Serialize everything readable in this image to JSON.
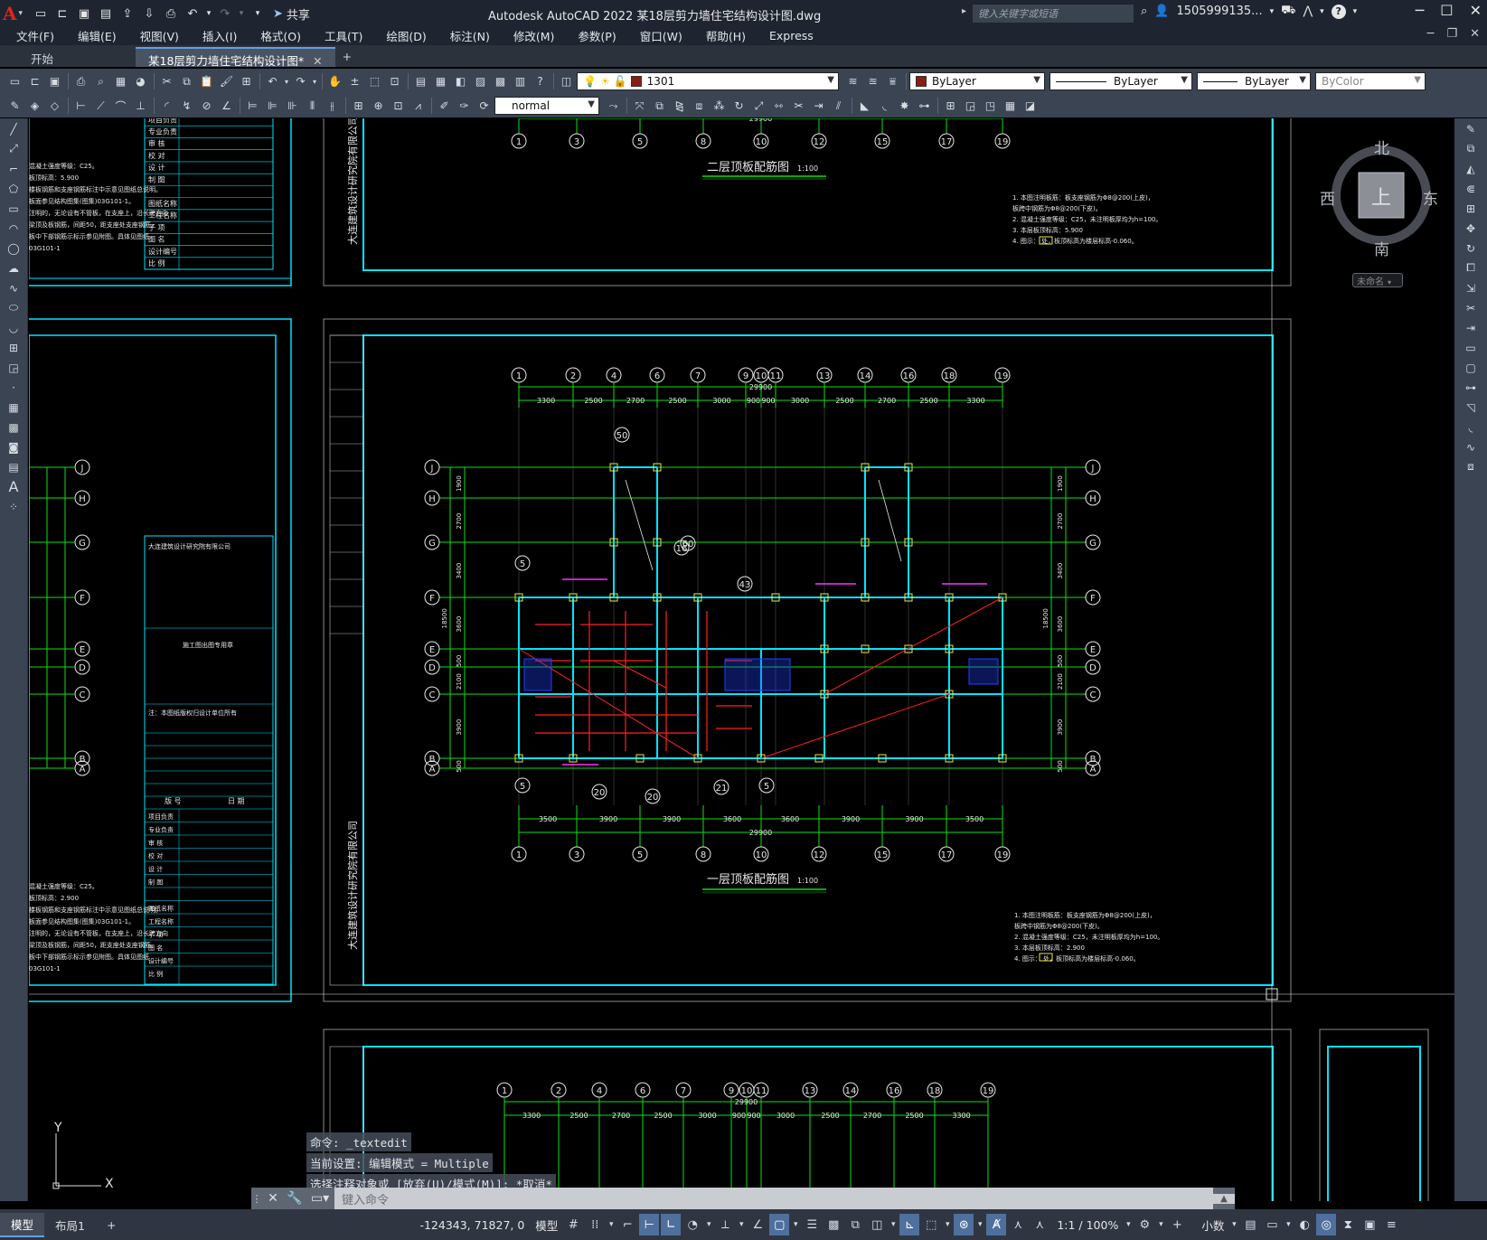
{
  "titlebar": {
    "app_letter": "A",
    "share_label": "共享",
    "title": "Autodesk AutoCAD 2022    某18层剪力墙住宅结构设计图.dwg",
    "search_placeholder": "键入关键字或短语",
    "user": "1505999135...",
    "help": "?"
  },
  "menu": {
    "items": [
      "文件(F)",
      "编辑(E)",
      "视图(V)",
      "插入(I)",
      "格式(O)",
      "工具(T)",
      "绘图(D)",
      "标注(N)",
      "修改(M)",
      "参数(P)",
      "窗口(W)",
      "帮助(H)",
      "Express"
    ]
  },
  "tabs": {
    "start": "开始",
    "active": "某18层剪力墙住宅结构设计图*",
    "plus": "+"
  },
  "toolbar": {
    "layer_name": "1301",
    "layer_color": "#8b1e10",
    "color_value": "ByLayer",
    "linetype_value": "ByLayer",
    "lineweight_value": "ByLayer",
    "plotstyle_value": "ByColor",
    "textstyle_value": "normal"
  },
  "viewcube": {
    "north": "北",
    "south": "南",
    "east": "东",
    "west": "西",
    "face": "上",
    "ucs_name": "未命名"
  },
  "drawing": {
    "top_title": "二层顶板配筋图",
    "top_scale": "1:100",
    "main_title": "一层顶板配筋图",
    "main_scale": "1:100",
    "overall_dim": "29900",
    "top_axes": [
      "1",
      "2",
      "4",
      "6",
      "7",
      "9",
      "10",
      "11",
      "13",
      "14",
      "16",
      "18",
      "19"
    ],
    "top_dims": [
      "3300",
      "2500",
      "2700",
      "2500",
      "3000",
      "900",
      "900",
      "3000",
      "2500",
      "2700",
      "2500",
      "3300"
    ],
    "bottom_axes": [
      "1",
      "3",
      "5",
      "8",
      "10",
      "12",
      "15",
      "17",
      "19"
    ],
    "bottom_dims": [
      "3500",
      "3900",
      "3900",
      "3600",
      "3600",
      "3900",
      "3900",
      "3500"
    ],
    "row_axes": [
      "J",
      "H",
      "G",
      "F",
      "E",
      "D",
      "C",
      "B",
      "A"
    ],
    "row_dims": [
      "1900",
      "2700",
      "3400",
      "3600",
      "500",
      "2100",
      "3900",
      "500"
    ],
    "total_height": "18500",
    "company_vertical": "大连建筑设计研究院有限公司",
    "notes_main": [
      "1. 本图注明板筋：板支座钢筋为Φ8@200(上皮)，",
      "   板跨中钢筋为Φ8@200(下皮)。",
      "2. 混凝土强度等级：C25，未注明板厚均为h=100。",
      "3. 本层板顶标高：2.900",
      "4. 图示：      处，板顶标高为楼层标高-0.060。"
    ],
    "notes_top": [
      "1. 本图注明板筋：板支座钢筋为Φ8@200(上皮)，",
      "   板跨中钢筋为Φ8@200(下皮)。",
      "2. 混凝土强度等级：C25，未注明板厚均为h=100。",
      "3. 本层板顶标高：5.900",
      "4. 图示：      处，板顶标高为楼层标高-0.060。"
    ],
    "left_notes_top": [
      "混凝土强度等级：C25。",
      "板顶标高：5.900",
      "楼板钢筋和支座钢筋标注中示意见图纸总说明。",
      "板面参见结构图集(图集)03G101-1。",
      "注明的，无论设有不管板，在支座上，沿长跨方向",
      "梁顶及板钢筋，间距50，距支座处支座钢筋。",
      "板中下部钢筋示标示参见附图。具体见图纸",
      "03G101-1"
    ],
    "left_notes_bottom": [
      "混凝土强度等级：C25。",
      "板顶标高：2.900",
      "楼板钢筋和支座钢筋标注中示意见图纸总说明。",
      "板面参见结构图集(图集)03G101-1。",
      "注明的，无论设有不管板，在支座上，沿长跨方向",
      "梁顶及板钢筋，间距50，距支座处支座钢筋。",
      "板中下部钢筋示标示参见附图。具体见图纸",
      "03G101-1"
    ],
    "titleblock_rows": [
      "项目负责",
      "专业负责",
      "审 核",
      "校 对",
      "设 计",
      "制 图",
      "",
      "图纸名称",
      "工程名称",
      "子 项",
      "图 名",
      "设计编号",
      "比 例"
    ],
    "titleblock_company": "大连建筑设计研究院有限公司",
    "titleblock_note": "注：本图纸版权归设计单位所有",
    "titleblock_seal": "施工图出图专用章",
    "date_label": "日 期",
    "ver_label": "版 号"
  },
  "command": {
    "history": [
      "命令: _textedit",
      "当前设置: 编辑模式 = Multiple",
      "选择注释对象或 [放弃(U)/模式(M)]: *取消*"
    ],
    "placeholder": "键入命令"
  },
  "ucs": {
    "x": "X",
    "y": "Y"
  },
  "status": {
    "tab_model": "模型",
    "tab_layout": "布局1",
    "tab_add": "+",
    "coords": "-124343, 71827, 0",
    "space": "模型",
    "scale": "1:1 / 100%",
    "units": "小数"
  }
}
